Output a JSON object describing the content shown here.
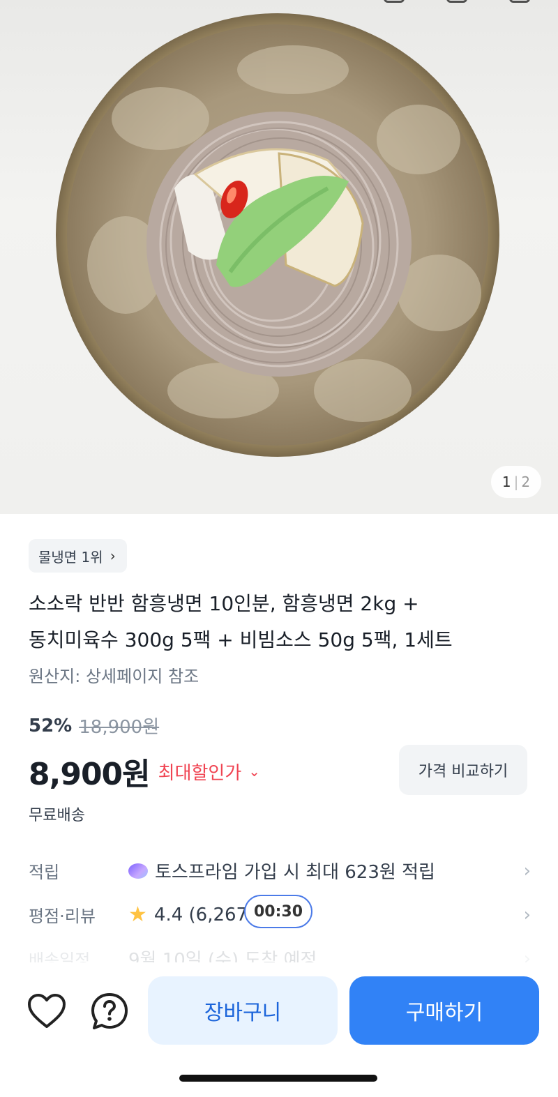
{
  "hero": {
    "image_alt": "물냉면",
    "page_current": "1",
    "page_total": "2"
  },
  "product": {
    "rank_chip": "물냉면 1위",
    "title_line1": "소소락 반반 함흥냉면 10인분, 함흥냉면 2kg +",
    "title_line2": "동치미육수 300g 5팩 + 비빔소스 50g 5팩, 1세트",
    "origin": "원산지: 상세페이지 참조",
    "discount_rate": "52%",
    "original_price": "18,900원",
    "price": "8,900원",
    "max_discount_label": "최대할인가",
    "compare_button": "가격 비교하기",
    "shipping": "무료배송"
  },
  "info_rows": {
    "points_label": "적립",
    "points_value": "토스프라임 가입 시 최대 623원 적립",
    "rating_label": "평점·리뷰",
    "rating_value": "4.4 (6,267)",
    "delivery_label": "배송일정",
    "delivery_value": "9월 10일 (수) 도착 예정"
  },
  "timer": "00:30",
  "bottom_bar": {
    "cart_label": "장바구니",
    "buy_label": "구매하기"
  },
  "colors": {
    "primary": "#3182f6",
    "cart_bg": "#e8f3ff",
    "discount_red": "#f04452",
    "star": "#ffc342"
  },
  "icons": [
    "heart-icon",
    "help-bubble-icon",
    "chevron-right-icon",
    "chevron-down-icon",
    "star-icon",
    "toss-prime-icon"
  ]
}
